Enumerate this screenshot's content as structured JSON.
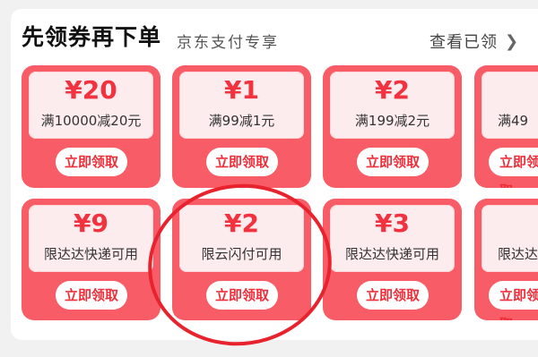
{
  "header": {
    "title": "先领券再下单",
    "subtitle": "京东支付专享",
    "view_all": "查看已领"
  },
  "coupons_row1": [
    {
      "amount": "¥20",
      "condition": "满10000减20元",
      "button": "立即领取"
    },
    {
      "amount": "¥1",
      "condition": "满99减1元",
      "button": "立即领取"
    },
    {
      "amount": "¥2",
      "condition": "满199减2元",
      "button": "立即领取"
    },
    {
      "amount": "",
      "condition": "满49",
      "button": "立即领取"
    }
  ],
  "coupons_row2": [
    {
      "amount": "¥9",
      "condition": "限达达快递可用",
      "button": "立即领取"
    },
    {
      "amount": "¥2",
      "condition": "限云闪付可用",
      "button": "立即领取"
    },
    {
      "amount": "¥3",
      "condition": "限达达快递可用",
      "button": "立即领取"
    },
    {
      "amount": "",
      "condition": "限达达",
      "button": "立即领取"
    }
  ],
  "colors": {
    "accent": "#f85d67",
    "price": "#f2323e",
    "highlight_circle": "#e8232e"
  }
}
